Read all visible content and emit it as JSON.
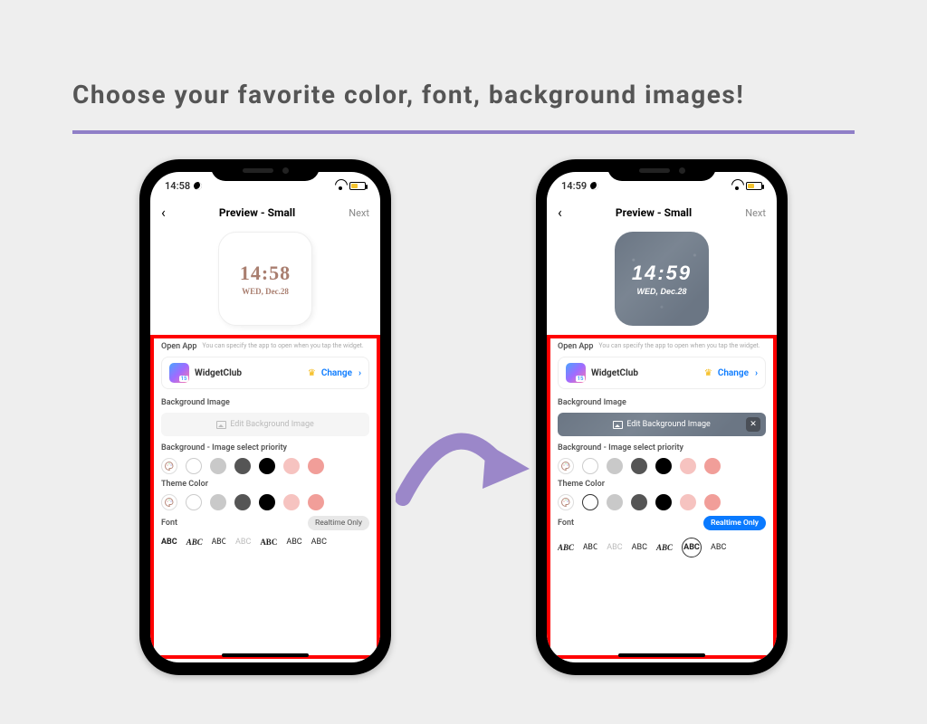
{
  "headline": "Choose your favorite color, font, background images!",
  "phone_left": {
    "status_time": "14:58",
    "nav_title": "Preview - Small",
    "nav_next": "Next",
    "widget_time": "14:58",
    "widget_date": "WED, Dec.28",
    "open_app_label": "Open App",
    "open_app_desc": "You can specify the app to open when you tap the widget.",
    "app_name": "WidgetClub",
    "change_label": "Change",
    "bg_image_label": "Background Image",
    "edit_bg_label": "Edit Background Image",
    "priority_label": "Background - Image select priority",
    "theme_label": "Theme Color",
    "font_label": "Font",
    "realtime_label": "Realtime Only",
    "font_sample": "ABC"
  },
  "phone_right": {
    "status_time": "14:59",
    "nav_title": "Preview - Small",
    "nav_next": "Next",
    "widget_time": "14:59",
    "widget_date": "WED, Dec.28",
    "open_app_label": "Open App",
    "open_app_desc": "You can specify the app to open when you tap the widget.",
    "app_name": "WidgetClub",
    "change_label": "Change",
    "bg_image_label": "Background Image",
    "edit_bg_label": "Edit Background Image",
    "priority_label": "Background - Image select priority",
    "theme_label": "Theme Color",
    "font_label": "Font",
    "realtime_label": "Realtime Only",
    "font_sample": "ABC"
  },
  "palette_colors": [
    "#ffffff",
    "#c9c9c9",
    "#555555",
    "#000000",
    "#f6c3c0",
    "#f19e99"
  ],
  "colors": {
    "accent_blue": "#0a7aff",
    "highlight_red": "#ff0000",
    "arrow": "#9b87c9"
  }
}
